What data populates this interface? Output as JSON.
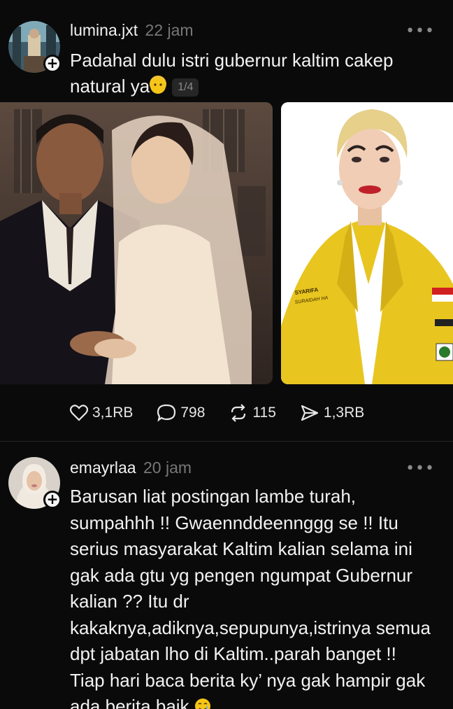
{
  "posts": [
    {
      "username": "lumina.jxt",
      "time": "22 jam",
      "text_line1": "Padahal dulu istri gubernur kaltim cakep",
      "text_line2": "natural ya",
      "counter": "1/4",
      "actions": {
        "likes": "3,1RB",
        "comments": "798",
        "reposts": "115",
        "shares": "1,3RB"
      },
      "image2_badge": "SYARIFA\nSURAIDAH HA"
    },
    {
      "username": "emayrlaa",
      "time": "20 jam",
      "lines": [
        "Barusan liat postingan lambe turah,",
        "sumpahhh !! Gwaennddeennggg se !! Itu",
        "serius masyarakat Kaltim kalian selama ini",
        "gak ada gtu yg pengen ngumpat Gubernur",
        "kalian ?? Itu dr",
        "kakaknya,adiknya,sepupunya,istrinya semua",
        "dpt jabatan lho di Kaltim..parah banget !!",
        "Tiap hari baca berita ky’ nya gak hampir gak",
        "ada berita baik"
      ]
    }
  ],
  "icons": [
    "more-icon",
    "heart-icon",
    "comment-icon",
    "repost-icon",
    "share-icon",
    "follow-plus-icon"
  ],
  "colors": {
    "background": "#0a0a0a",
    "text": "#f2f2f2",
    "muted": "#777777",
    "yellow_jacket": "#e9c520"
  }
}
